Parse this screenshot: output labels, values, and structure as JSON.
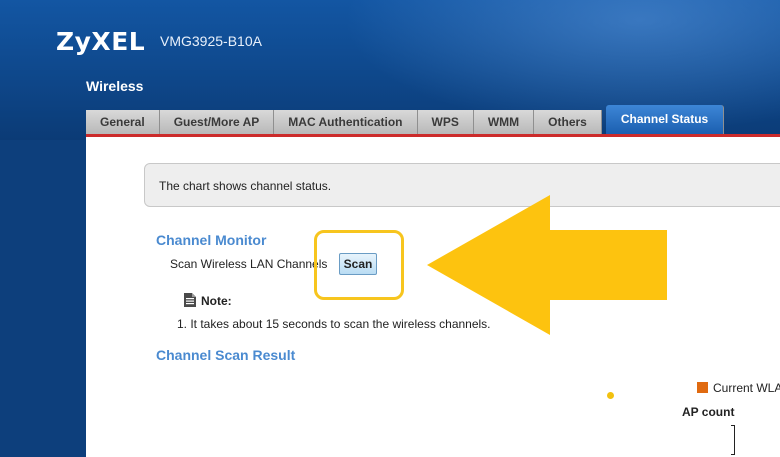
{
  "header": {
    "logo": "ZyXEL",
    "model": "VMG3925-B10A",
    "section": "Wireless"
  },
  "tabs": [
    {
      "label": "General",
      "active": false
    },
    {
      "label": "Guest/More AP",
      "active": false
    },
    {
      "label": "MAC Authentication",
      "active": false
    },
    {
      "label": "WPS",
      "active": false
    },
    {
      "label": "WMM",
      "active": false
    },
    {
      "label": "Others",
      "active": false
    },
    {
      "label": "Channel Status",
      "active": true
    }
  ],
  "info": {
    "text": "The chart shows channel status."
  },
  "channel_monitor": {
    "title": "Channel Monitor",
    "scan_label": "Scan Wireless LAN Channels",
    "scan_button": "Scan"
  },
  "note": {
    "label": "Note:",
    "items": [
      "1. It takes about 15 seconds to scan the wireless channels."
    ]
  },
  "scan_result": {
    "title": "Channel Scan Result",
    "legend": "Current WLA",
    "ap_count_label": "AP count"
  },
  "colors": {
    "active_tab": "#2a6fc4",
    "tab_underline": "#cc2b2b",
    "heading_blue": "#4a8ad0",
    "annotation_yellow": "#f7c51e",
    "legend_orange": "#e06a10"
  },
  "icons": {
    "note": "note-document-icon",
    "annotation": "arrow-left-icon"
  }
}
